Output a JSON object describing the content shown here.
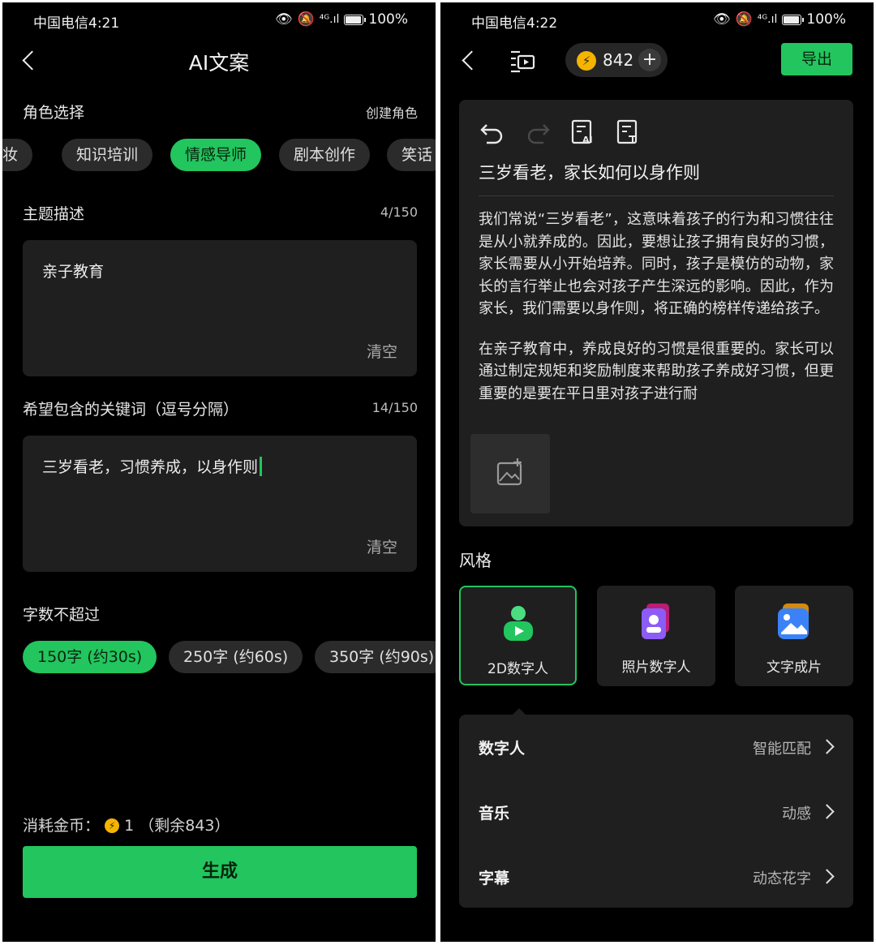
{
  "left_screen": {
    "status": {
      "carrier_time": "中国电信4:21",
      "battery": "100%"
    },
    "title": "AI文案",
    "role_section": {
      "label": "角色选择",
      "create_link": "创建角色",
      "chips": [
        "妆",
        "知识培训",
        "情感导师",
        "剧本创作",
        "笑话"
      ],
      "selected": "情感导师"
    },
    "topic": {
      "label": "主题描述",
      "count": "4/150",
      "value": "亲子教育",
      "clear": "清空"
    },
    "keywords": {
      "label": "希望包含的关键词（逗号分隔）",
      "count": "14/150",
      "value": "三岁看老，习惯养成，以身作则",
      "clear": "清空"
    },
    "length": {
      "label": "字数不超过",
      "options": [
        "150字 (约30s)",
        "250字 (约60s)",
        "350字 (约90s)"
      ],
      "selected": "150字 (约30s)"
    },
    "cost": {
      "prefix": "消耗金币：",
      "amount": "1",
      "remaining": "（剩余843）"
    },
    "generate_button": "生成"
  },
  "right_screen": {
    "status": {
      "carrier_time": "中国电信4:22",
      "battery": "100%"
    },
    "coins": "842",
    "export_button": "导出",
    "document": {
      "title": "三岁看老，家长如何以身作则",
      "paragraphs": [
        "我们常说“三岁看老”，这意味着孩子的行为和习惯往往是从小就养成的。因此，要想让孩子拥有良好的习惯，家长需要从小开始培养。同时，孩子是模仿的动物，家长的言行举止也会对孩子产生深远的影响。因此，作为家长，我们需要以身作则，将正确的榜样传递给孩子。",
        "在亲子教育中，养成良好的习惯是很重要的。家长可以通过制定规矩和奖励制度来帮助孩子养成好习惯，但更重要的是要在平日里对孩子进行耐"
      ]
    },
    "style": {
      "label": "风格",
      "options": [
        "2D数字人",
        "照片数字人",
        "文字成片"
      ],
      "selected": "2D数字人"
    },
    "settings": [
      {
        "key": "数字人",
        "value": "智能匹配"
      },
      {
        "key": "音乐",
        "value": "动感"
      },
      {
        "key": "字幕",
        "value": "动态花字"
      }
    ],
    "colors": {
      "accent": "#22c55e",
      "background": "#000000",
      "card": "#1f1f1f"
    }
  }
}
